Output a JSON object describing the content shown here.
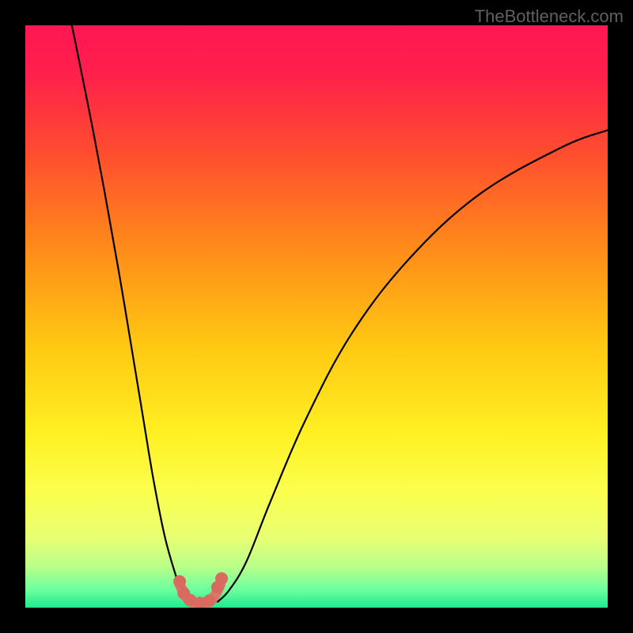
{
  "watermark": "TheBottleneck.com",
  "chart_data": {
    "type": "line",
    "title": "",
    "xlabel": "",
    "ylabel": "",
    "xlim": [
      0,
      100
    ],
    "ylim": [
      0,
      100
    ],
    "background": {
      "type": "vertical-gradient",
      "stops": [
        {
          "offset": 0,
          "color": "#ff1654"
        },
        {
          "offset": 0.08,
          "color": "#ff1f4c"
        },
        {
          "offset": 0.22,
          "color": "#ff4d2f"
        },
        {
          "offset": 0.38,
          "color": "#ff8a1a"
        },
        {
          "offset": 0.55,
          "color": "#ffc812"
        },
        {
          "offset": 0.7,
          "color": "#fff023"
        },
        {
          "offset": 0.8,
          "color": "#fbff4d"
        },
        {
          "offset": 0.88,
          "color": "#e8ff73"
        },
        {
          "offset": 0.93,
          "color": "#b8ff8a"
        },
        {
          "offset": 0.97,
          "color": "#6aff9e"
        },
        {
          "offset": 1.0,
          "color": "#20e98f"
        }
      ]
    },
    "series": [
      {
        "name": "left-branch",
        "type": "curve",
        "stroke": "#000000",
        "x": [
          8,
          12,
          16,
          20,
          22,
          24,
          26,
          27,
          28
        ],
        "y": [
          100,
          80,
          58,
          34,
          22,
          12,
          5,
          2,
          1
        ]
      },
      {
        "name": "right-branch",
        "type": "curve",
        "stroke": "#000000",
        "x": [
          33,
          35,
          38,
          42,
          48,
          56,
          66,
          78,
          92,
          100
        ],
        "y": [
          1,
          3,
          8,
          18,
          32,
          47,
          60,
          71,
          79,
          82
        ]
      },
      {
        "name": "valley-band",
        "type": "thick-curve",
        "stroke": "#e0766b",
        "x": [
          26.5,
          27.5,
          28.5,
          30,
          31.5,
          32.5,
          33.5
        ],
        "y": [
          4,
          2,
          1,
          0.5,
          1,
          2,
          4
        ]
      }
    ],
    "markers": {
      "color": "#d86a60",
      "points": [
        {
          "x": 26.5,
          "y": 4.5
        },
        {
          "x": 27.2,
          "y": 2.5
        },
        {
          "x": 28.3,
          "y": 1.3
        },
        {
          "x": 30.0,
          "y": 0.8
        },
        {
          "x": 31.6,
          "y": 1.2
        },
        {
          "x": 33.0,
          "y": 3.5
        },
        {
          "x": 33.7,
          "y": 5.0
        }
      ]
    }
  }
}
